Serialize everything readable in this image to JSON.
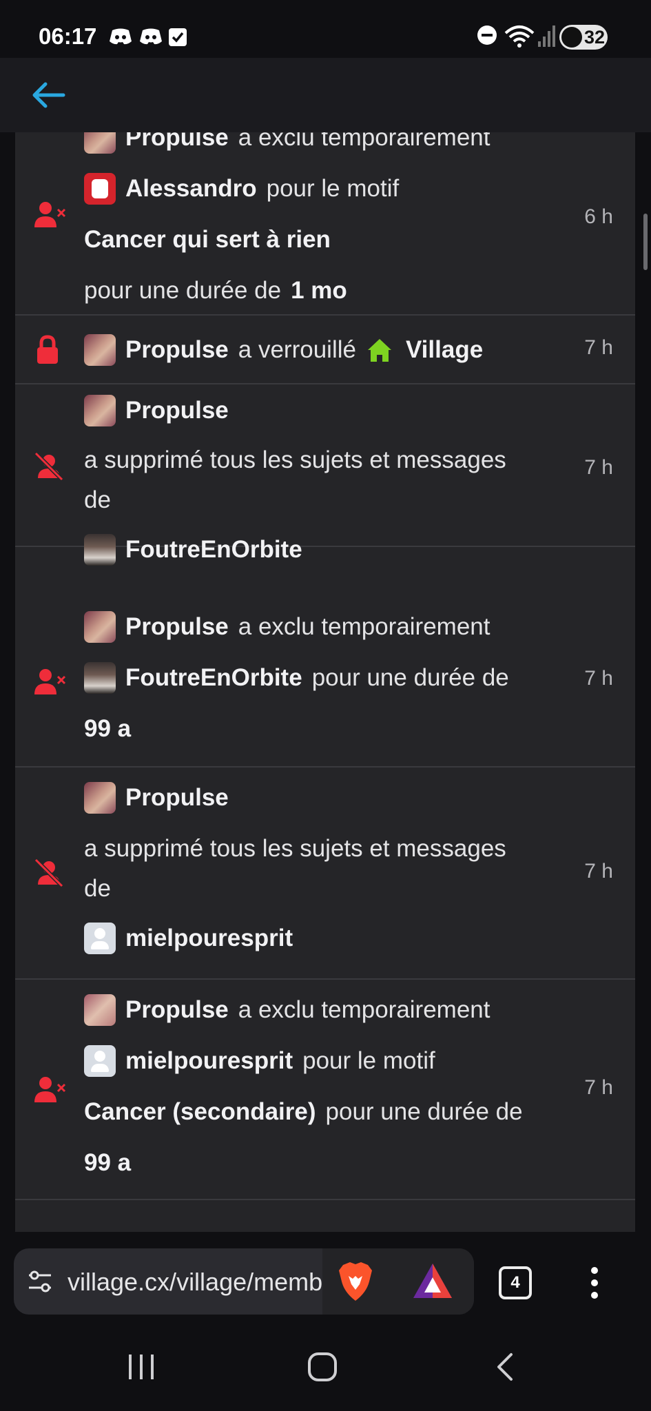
{
  "status_bar": {
    "time": "06:17",
    "battery": "32",
    "icons": [
      "discord-icon",
      "discord-icon",
      "checkbox-icon",
      "do-not-disturb-icon",
      "wifi-icon",
      "signal-icon",
      "battery-icon"
    ]
  },
  "header": {
    "back_icon": "back-arrow-icon"
  },
  "entries": [
    {
      "icon": "user-ban-icon",
      "time": "6 h",
      "lines": [
        {
          "avatar": "Propulse",
          "user": "Propulse",
          "text": "a exclu temporairement"
        },
        {
          "avatar": "Alessandro",
          "user": "Alessandro",
          "text": "pour le motif"
        },
        {
          "reason": "Cancer qui sert à rien"
        },
        {
          "text": "pour une durée de",
          "value": "1 mo"
        }
      ]
    },
    {
      "icon": "lock-icon",
      "time": "7 h",
      "lines": [
        {
          "avatar": "Propulse",
          "user": "Propulse",
          "text": "a verrouillé",
          "place_icon": "home-icon",
          "place": "Village"
        }
      ]
    },
    {
      "icon": "user-slash-icon",
      "time": "7 h",
      "lines": [
        {
          "avatar": "Propulse",
          "user": "Propulse"
        },
        {
          "text": "a supprimé tous les sujets et messages"
        },
        {
          "text": "de"
        },
        {
          "avatar": "FoutreEnOrbite",
          "user": "FoutreEnOrbite"
        }
      ]
    },
    {
      "icon": "user-ban-icon",
      "time": "7 h",
      "lines": [
        {
          "avatar": "Propulse",
          "user": "Propulse",
          "text": "a exclu temporairement"
        },
        {
          "avatar": "FoutreEnOrbite",
          "user": "FoutreEnOrbite",
          "text": "pour une durée de"
        },
        {
          "value": "99 a"
        }
      ]
    },
    {
      "icon": "user-slash-icon",
      "time": "7 h",
      "lines": [
        {
          "avatar": "Propulse",
          "user": "Propulse"
        },
        {
          "text": "a supprimé tous les sujets et messages"
        },
        {
          "text": "de"
        },
        {
          "avatar": "mielpouresprit",
          "user": "mielpouresprit"
        }
      ]
    },
    {
      "icon": "user-ban-icon",
      "time": "7 h",
      "lines": [
        {
          "avatar": "Propulse",
          "user": "Propulse",
          "text": "a exclu temporairement"
        },
        {
          "avatar": "mielpouresprit",
          "user": "mielpouresprit",
          "text": "pour le motif"
        },
        {
          "reason": "Cancer (secondaire)",
          "text": "pour une durée de"
        },
        {
          "value": "99 a"
        }
      ]
    }
  ],
  "browser": {
    "url": "village.cx/village/membres",
    "tab_count": "4",
    "icons": [
      "site-settings-icon",
      "brave-shields-icon",
      "brave-rewards-icon",
      "more-options-icon"
    ]
  },
  "nav_bar": {
    "icons": [
      "recent-apps-icon",
      "home-button-icon",
      "back-nav-icon"
    ]
  }
}
